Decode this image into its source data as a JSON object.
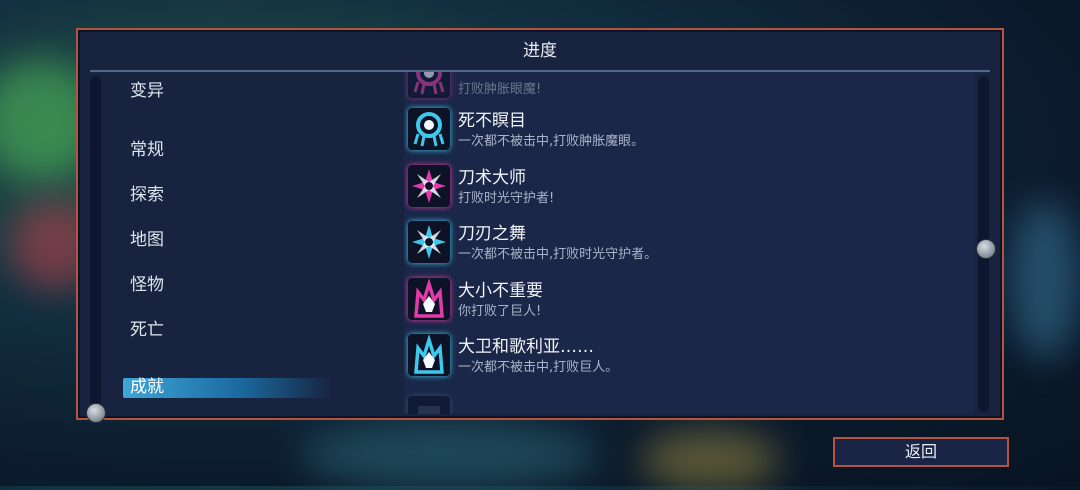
{
  "panel": {
    "title": "进度"
  },
  "categories": [
    {
      "label": "变异",
      "selected": false
    },
    {
      "label": "常规",
      "selected": false
    },
    {
      "label": "探索",
      "selected": false
    },
    {
      "label": "地图",
      "selected": false
    },
    {
      "label": "怪物",
      "selected": false
    },
    {
      "label": "死亡",
      "selected": false
    },
    {
      "label": "成就",
      "selected": true
    }
  ],
  "achievements": [
    {
      "name": "",
      "desc": "打败肿胀眼魔!",
      "icon": "tentacle-eye-icon",
      "color": "#e23aa8"
    },
    {
      "name": "死不瞑目",
      "desc": "一次都不被击中,打败肿胀魔眼。",
      "icon": "tentacle-eye-icon",
      "color": "#3fc8ec"
    },
    {
      "name": "刀术大师",
      "desc": "打败时光守护者!",
      "icon": "shuriken-icon",
      "color": "#e23aa8"
    },
    {
      "name": "刀刃之舞",
      "desc": "一次都不被击中,打败时光守护者。",
      "icon": "shuriken-icon",
      "color": "#3fc8ec"
    },
    {
      "name": "大小不重要",
      "desc": "你打败了巨人!",
      "icon": "giant-crown-icon",
      "color": "#e23aa8"
    },
    {
      "name": "大卫和歌利亚……",
      "desc": "一次都不被击中,打败巨人。",
      "icon": "giant-crown-icon",
      "color": "#3fc8ec"
    },
    {
      "name": "",
      "desc": "",
      "icon": "partial-icon",
      "color": "#5a6a8a"
    }
  ],
  "footer": {
    "back_label": "返回"
  }
}
